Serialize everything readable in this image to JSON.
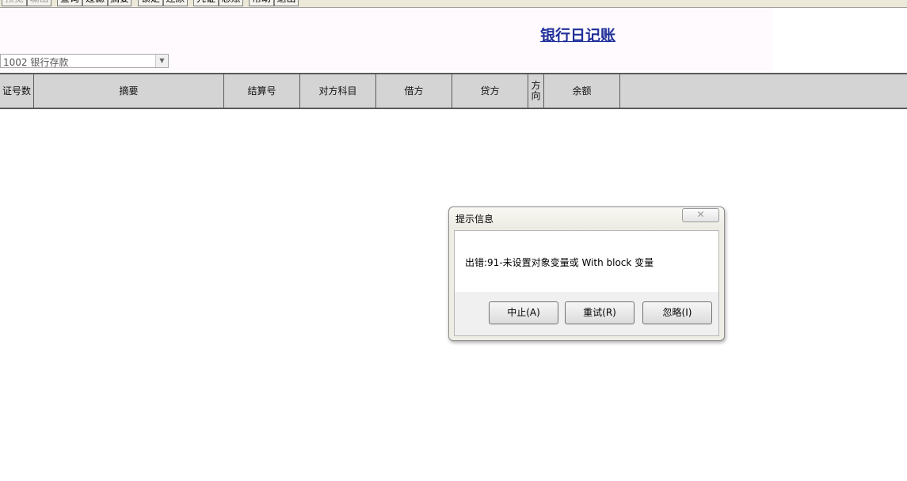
{
  "toolbar": {
    "items": [
      {
        "label": "预览",
        "enabled": false
      },
      {
        "label": "输出",
        "enabled": false
      },
      {
        "label": "查询",
        "enabled": true
      },
      {
        "label": "过滤",
        "enabled": true
      },
      {
        "label": "摘要",
        "enabled": true
      },
      {
        "label": "锁定",
        "enabled": true
      },
      {
        "label": "还原",
        "enabled": true
      },
      {
        "label": "凭证",
        "enabled": true
      },
      {
        "label": "总账",
        "enabled": true
      },
      {
        "label": "帮助",
        "enabled": true
      },
      {
        "label": "退出",
        "enabled": true
      }
    ]
  },
  "page_title": "银行日记账",
  "account_select": {
    "value": "1002 银行存款",
    "arrow_icon": "chevron-down-icon"
  },
  "grid": {
    "columns": [
      "证号数",
      "摘要",
      "结算号",
      "对方科目",
      "借方",
      "贷方",
      "方向",
      "余额",
      ""
    ]
  },
  "dialog": {
    "title": "提示信息",
    "close_glyph": "✕",
    "message": "出错:91-未设置对象变量或 With block 变量",
    "buttons": {
      "abort": "中止(A)",
      "retry": "重试(R)",
      "ignore": "忽略(I)"
    }
  },
  "colors": {
    "title": "#1f2f9a",
    "grid_header_bg": "#d4d4d4",
    "title_band_bg": "#fffafd"
  }
}
